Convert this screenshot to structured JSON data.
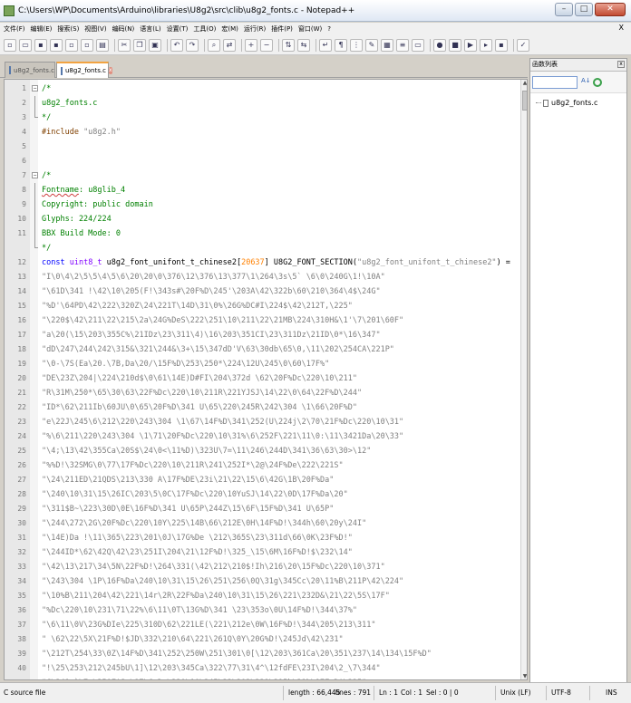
{
  "window": {
    "title": "C:\\Users\\WP\\Documents\\Arduino\\libraries\\U8g2\\src\\clib\\u8g2_fonts.c - Notepad++",
    "controls": {
      "minimize": "–",
      "maximize": "□",
      "close": "✕"
    }
  },
  "menu": {
    "items": [
      "文件(F)",
      "编辑(E)",
      "搜索(S)",
      "视图(V)",
      "编码(N)",
      "语言(L)",
      "设置(T)",
      "工具(O)",
      "宏(M)",
      "运行(R)",
      "插件(P)",
      "窗口(W)",
      "?"
    ],
    "close_label": "X"
  },
  "tabs": [
    {
      "label": "u8g2_fonts.c",
      "active": false
    },
    {
      "label": "u8g2_fonts.c",
      "active": true,
      "close": "x"
    }
  ],
  "function_panel": {
    "title": "函数列表",
    "close": "x",
    "sort_label": "A↓",
    "tree_item": "u8g2_fonts.c"
  },
  "editor": {
    "lines": [
      {
        "n": "1",
        "fold": "box",
        "tokens": [
          {
            "c": "c-comment",
            "t": "/*"
          }
        ]
      },
      {
        "n": "2",
        "fold": "bar",
        "tokens": [
          {
            "c": "c-comment",
            "t": "  u8g2_fonts.c"
          }
        ]
      },
      {
        "n": "3",
        "fold": "end",
        "tokens": [
          {
            "c": "c-comment",
            "t": "*/"
          }
        ]
      },
      {
        "n": "4",
        "fold": "",
        "tokens": [
          {
            "c": "c-prep",
            "t": "#include "
          },
          {
            "c": "c-str",
            "t": "\"u8g2.h\""
          }
        ]
      },
      {
        "n": "5",
        "fold": "",
        "tokens": []
      },
      {
        "n": "6",
        "fold": "",
        "tokens": []
      },
      {
        "n": "7",
        "fold": "box",
        "tokens": [
          {
            "c": "c-comment",
            "t": "/*"
          }
        ]
      },
      {
        "n": "8",
        "fold": "bar",
        "tokens": [
          {
            "c": "c-comment c-hl",
            "t": "  Fontname"
          },
          {
            "c": "c-comment",
            "t": ": u8glib_4"
          }
        ]
      },
      {
        "n": "9",
        "fold": "bar",
        "tokens": [
          {
            "c": "c-comment",
            "t": "  Copyright: public domain"
          }
        ]
      },
      {
        "n": "10",
        "fold": "bar",
        "tokens": [
          {
            "c": "c-comment",
            "t": "  Glyphs: 224/224"
          }
        ]
      },
      {
        "n": "11",
        "fold": "bar",
        "tokens": [
          {
            "c": "c-comment",
            "t": "  BBX Build Mode: 0"
          }
        ]
      },
      {
        "n": "",
        "fold": "end",
        "tokens": [
          {
            "c": "c-comment",
            "t": "  */"
          }
        ]
      },
      {
        "n": "12",
        "fold": "",
        "tokens": [
          {
            "c": "c-kw",
            "t": "const "
          },
          {
            "c": "c-type",
            "t": "uint8_t "
          },
          {
            "c": "c-def",
            "t": "u8g2_font_unifont_t_chinese2["
          },
          {
            "c": "c-num",
            "t": "20637"
          },
          {
            "c": "c-def",
            "t": "] U8G2_FONT_SECTION("
          },
          {
            "c": "c-str",
            "t": "\"u8g2_font_unifont_t_chinese2\""
          },
          {
            "c": "c-def",
            "t": ") ="
          }
        ]
      },
      {
        "n": "13",
        "fold": "",
        "tokens": [
          {
            "c": "c-str",
            "t": "  \"I\\0\\4\\2\\5\\5\\4\\5\\6\\20\\20\\0\\376\\12\\376\\13\\377\\1\\264\\3s\\5` \\6\\0\\240G\\1!\\10A\""
          }
        ]
      },
      {
        "n": "14",
        "fold": "",
        "tokens": [
          {
            "c": "c-str",
            "t": "  \"\\61D\\341 !\\42\\10\\205(F!\\343s#\\20F%D\\245'\\203A\\42\\322b\\60\\210\\364\\4$\\24G\""
          }
        ]
      },
      {
        "n": "15",
        "fold": "",
        "tokens": [
          {
            "c": "c-str",
            "t": "  \"%D'\\64PD\\42\\222\\320Z\\24\\221T\\14D\\31\\0%\\26G%DC#I\\224$\\42\\212T,\\225\""
          }
        ]
      },
      {
        "n": "16",
        "fold": "",
        "tokens": [
          {
            "c": "c-str",
            "t": "  \"\\220$\\42\\211\\22\\215\\2a\\24G%DeS\\222\\251\\10\\211\\22\\21MB\\224\\310H&\\1'\\7\\201\\60F\""
          }
        ]
      },
      {
        "n": "17",
        "fold": "",
        "tokens": [
          {
            "c": "c-str",
            "t": "  \"a\\20(\\15\\203\\355C%\\21IDz\\23\\311\\4)\\16\\203\\351CI\\23\\311Dz\\21ID\\0*\\16\\347\""
          }
        ]
      },
      {
        "n": "18",
        "fold": "",
        "tokens": [
          {
            "c": "c-str",
            "t": "  \"dD\\247\\244\\242\\315&\\321\\244&\\3+\\15\\347dD'V\\63\\30db\\65\\0,\\11\\202\\254CA\\221P\""
          }
        ]
      },
      {
        "n": "19",
        "fold": "",
        "tokens": [
          {
            "c": "c-str",
            "t": "  \"\\0-\\7S(Ea\\20.\\7B,Da\\20/\\15F%D\\253\\250*\\224\\12U\\245\\0\\60\\17F%\""
          }
        ]
      },
      {
        "n": "20",
        "fold": "",
        "tokens": [
          {
            "c": "c-str",
            "t": "  \"DE\\23Z\\204|\\224\\210d$\\0\\61\\14E)D#FI\\204\\372d \\62\\20F%Dc\\220\\10\\211\""
          }
        ]
      },
      {
        "n": "21",
        "fold": "",
        "tokens": [
          {
            "c": "c-str",
            "t": "  \"R\\31M\\250*\\65\\30\\63\\22F%Dc\\220\\10\\211R\\221YJSJ\\14\\22\\0\\64\\22F%D\\244\""
          }
        ]
      },
      {
        "n": "22",
        "fold": "",
        "tokens": [
          {
            "c": "c-str",
            "t": "  \"ID*\\62\\211Ib\\60JU\\0\\65\\20F%D\\341 U\\65\\220\\245R\\242\\304 \\1\\66\\20F%D\""
          }
        ]
      },
      {
        "n": "23",
        "fold": "",
        "tokens": [
          {
            "c": "c-str",
            "t": "  \"e\\22J\\245\\6\\212\\220\\243\\304 \\1\\67\\14F%D\\341\\252(U\\224j\\2\\70\\21F%Dc\\220\\10\\31\""
          }
        ]
      },
      {
        "n": "24",
        "fold": "",
        "tokens": [
          {
            "c": "c-str",
            "t": "  \"%\\6\\211\\220\\243\\304 \\1\\71\\20F%Dc\\220\\10\\31%\\6\\252F\\221\\11\\0:\\11\\3421Da\\20\\33\""
          }
        ]
      },
      {
        "n": "25",
        "fold": "",
        "tokens": [
          {
            "c": "c-str",
            "t": "  \"\\4;\\13\\42\\355Ca\\20S$\\24\\0<\\11%D)\\323U\\7=\\11\\246\\244D\\341\\36\\63\\30>\\12\""
          }
        ]
      },
      {
        "n": "26",
        "fold": "",
        "tokens": [
          {
            "c": "c-str",
            "t": "  \"%%D!\\32SMG\\0\\77\\17F%Dc\\220\\10\\211R\\241\\252I*\\2@\\24F%De\\222\\221S\""
          }
        ]
      },
      {
        "n": "27",
        "fold": "",
        "tokens": [
          {
            "c": "c-str",
            "t": "  \"\\24\\211ED\\21QDS\\213\\330 A\\17F%DE\\23i\\21\\22\\15\\6\\42G\\1B\\20F%Da\""
          }
        ]
      },
      {
        "n": "28",
        "fold": "",
        "tokens": [
          {
            "c": "c-str",
            "t": "  \"\\240\\10\\31\\15\\26IC\\203\\5\\0C\\17F%Dc\\220\\10YuSJ\\14\\22\\0D\\17F%Da\\20\""
          }
        ]
      },
      {
        "n": "29",
        "fold": "",
        "tokens": [
          {
            "c": "c-str",
            "t": "  \"\\311$B~\\223\\30D\\0E\\16F%D\\341 U\\65P\\244Z\\15\\6F\\15F%D\\341 U\\65P\""
          }
        ]
      },
      {
        "n": "30",
        "fold": "",
        "tokens": [
          {
            "c": "c-str",
            "t": "  \"\\244\\272\\2G\\20F%Dc\\220\\10Y\\225\\14B\\66\\212E\\0H\\14F%D!\\344h\\60\\20y\\24I\""
          }
        ]
      },
      {
        "n": "31",
        "fold": "",
        "tokens": [
          {
            "c": "c-str",
            "t": "  \"\\14E)Da !\\11\\365\\223\\201\\0J\\17G%De \\212\\365S\\23\\311d\\66\\0K\\23F%D!\""
          }
        ]
      },
      {
        "n": "32",
        "fold": "",
        "tokens": [
          {
            "c": "c-str",
            "t": "  \"\\244ID*\\62\\42Q\\42\\23\\251I\\204\\21\\12F%D!\\325_\\15\\6M\\16F%D!$\\232\\14\""
          }
        ]
      },
      {
        "n": "33",
        "fold": "",
        "tokens": [
          {
            "c": "c-str",
            "t": "  \"\\42\\13\\217\\34\\5N\\22F%D!\\264\\331(\\42\\212\\210$!Ih\\216\\20\\15F%Dc\\220\\10\\371\""
          }
        ]
      },
      {
        "n": "34",
        "fold": "",
        "tokens": [
          {
            "c": "c-str",
            "t": "  \"\\243\\304 \\1P\\16F%Da\\240\\10\\31\\15\\26\\251\\256\\0Q\\31g\\345Cc\\20\\11%B\\211P\\42\\224\""
          }
        ]
      },
      {
        "n": "35",
        "fold": "",
        "tokens": [
          {
            "c": "c-str",
            "t": "  \"\\10%B\\211\\204\\42\\221\\14r\\2R\\22F%Da\\240\\10\\31\\15\\26\\221\\232D&\\21\\22\\5S\\17F\""
          }
        ]
      },
      {
        "n": "36",
        "fold": "",
        "tokens": [
          {
            "c": "c-str",
            "t": "  \"%Dc\\220\\10\\231\\71\\22%\\6\\11\\0T\\13G%D\\341 \\23\\353o\\0U\\14F%D!\\344\\37%\""
          }
        ]
      },
      {
        "n": "37",
        "fold": "",
        "tokens": [
          {
            "c": "c-str",
            "t": "  \"\\6\\11\\0V\\23G%DIe\\225\\310D\\62\\221LE(\\221\\212e\\0W\\16F%D!\\344\\205\\213\\311\""
          }
        ]
      },
      {
        "n": "38",
        "fold": "",
        "tokens": [
          {
            "c": "c-str",
            "t": "  \" \\62\\22\\5X\\21F%D!$JD\\332\\210\\64\\221\\261Q\\0Y\\20G%D!\\245Jd\\42\\231\""
          }
        ]
      },
      {
        "n": "39",
        "fold": "",
        "tokens": [
          {
            "c": "c-str",
            "t": "  \"\\212T\\254\\33\\0Z\\14F%D\\341\\252\\250W\\251\\301\\0[\\12\\203\\361Ca\\20\\351\\237\\14\\134\\15F%D\""
          }
        ]
      },
      {
        "n": "40",
        "fold": "",
        "tokens": [
          {
            "c": "c-str",
            "t": "  \"!\\25\\253\\212\\245bU\\1]\\12\\203\\345Ca\\322\\77\\31\\4^\\12fdFE\\23I\\204\\2_\\7\\344\""
          }
        ]
      },
      {
        "n": "41",
        "fold": "",
        "tokens": [
          {
            "c": "c-str",
            "t": "  \"C\\341 `\\7c\\250F!Sa\\17\\6%Dc\\220\\10\\245\\22\\203\\221\\215b\\21b\\17F%D!\\325\""
          }
        ]
      }
    ]
  },
  "statusbar": {
    "lang": "C source file",
    "length": "length : 66,445",
    "lines": "lines : 791",
    "ln": "Ln : 1",
    "col": "Col : 1",
    "sel": "Sel : 0 | 0",
    "eol": "Unix (LF)",
    "encoding": "UTF-8",
    "mode": "INS"
  }
}
